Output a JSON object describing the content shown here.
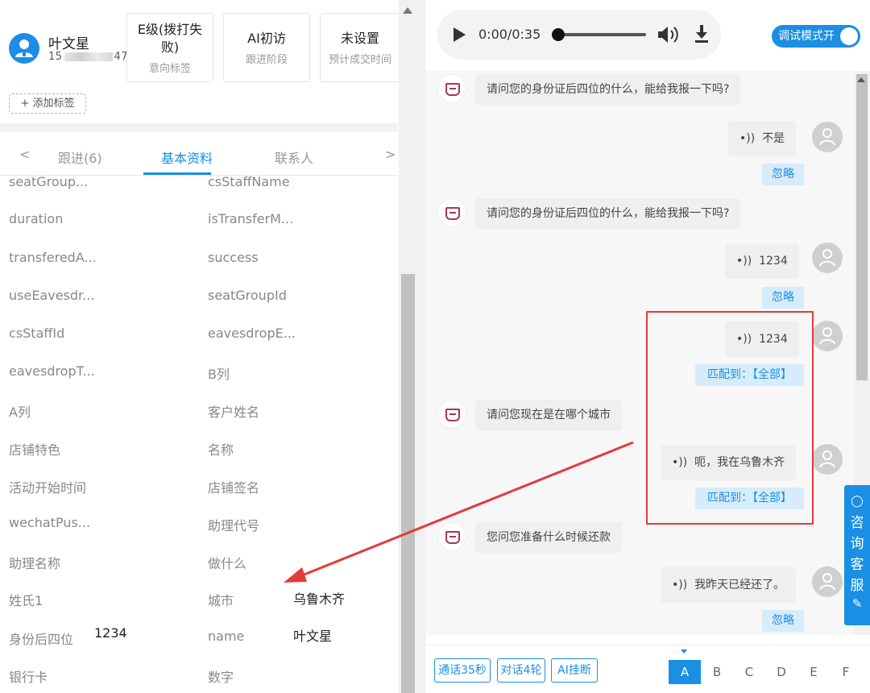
{
  "customer": {
    "name": "叶文星",
    "phone_prefix": "15",
    "phone_suffix": "47"
  },
  "cards": [
    {
      "value": "E级(拨打失败)",
      "label": "意向标签"
    },
    {
      "value": "AI初访",
      "label": "跟进阶段"
    },
    {
      "value": "未设置",
      "label": "预计成交时间"
    }
  ],
  "add_tag": "+ 添加标签",
  "tabs": {
    "prev": "<",
    "next": ">",
    "items": [
      "跟进(6)",
      "基本资料",
      "联系人"
    ],
    "active": 1
  },
  "fields": [
    {
      "l1": "seatGroup...",
      "v1": "",
      "l2": "csStaffName",
      "v2": ""
    },
    {
      "l1": "duration",
      "v1": "",
      "l2": "isTransferM...",
      "v2": ""
    },
    {
      "l1": "transferedA...",
      "v1": "",
      "l2": "success",
      "v2": ""
    },
    {
      "l1": "useEavesdr...",
      "v1": "",
      "l2": "seatGroupId",
      "v2": ""
    },
    {
      "l1": "csStaffId",
      "v1": "",
      "l2": "eavesdropE...",
      "v2": ""
    },
    {
      "l1": "eavesdropT...",
      "v1": "",
      "l2": "B列",
      "v2": ""
    },
    {
      "l1": "A列",
      "v1": "",
      "l2": "客户姓名",
      "v2": ""
    },
    {
      "l1": "店铺特色",
      "v1": "",
      "l2": "名称",
      "v2": ""
    },
    {
      "l1": "活动开始时间",
      "v1": "",
      "l2": "店铺签名",
      "v2": ""
    },
    {
      "l1": "wechatPus...",
      "v1": "",
      "l2": "助理代号",
      "v2": ""
    },
    {
      "l1": "助理名称",
      "v1": "",
      "l2": "做什么",
      "v2": ""
    },
    {
      "l1": "姓氏1",
      "v1": "",
      "l2": "城市",
      "v2": "乌鲁木齐"
    },
    {
      "l1": "身份后四位",
      "v1": "1234",
      "l2": "name",
      "v2": "叶文星"
    },
    {
      "l1": "银行卡",
      "v1": "",
      "l2": "数字",
      "v2": ""
    }
  ],
  "player": {
    "time": "0:00/0:35"
  },
  "debug_toggle": "调试模式开",
  "chat": {
    "bot1": "请问您的身份证后四位的什么，能给我报一下吗?",
    "user1": "不是",
    "ignore1": "忽略",
    "bot2": "请问您的身份证后四位的什么，能给我报一下吗?",
    "user2": "1234",
    "ignore2": "忽略",
    "user3": "1234",
    "match1": "匹配到：【全部】",
    "bot3": "请问您现在是在哪个城市",
    "user4": "呃，我在乌鲁木齐",
    "match2": "匹配到：【全部】",
    "bot4": "您问您准备什么时候还款",
    "user5": "我昨天已经还了。",
    "ignore3": "忽略"
  },
  "bottom": {
    "btn1": "通话35秒",
    "btn2": "对话4轮",
    "btn3": "AI挂断",
    "letters": [
      "A",
      "B",
      "C",
      "D",
      "E",
      "F"
    ]
  },
  "service": {
    "chars": [
      "咨",
      "询",
      "客",
      "服"
    ]
  },
  "colors": {
    "accent": "#1a8fe3",
    "annotation_red": "#e53a3a"
  }
}
